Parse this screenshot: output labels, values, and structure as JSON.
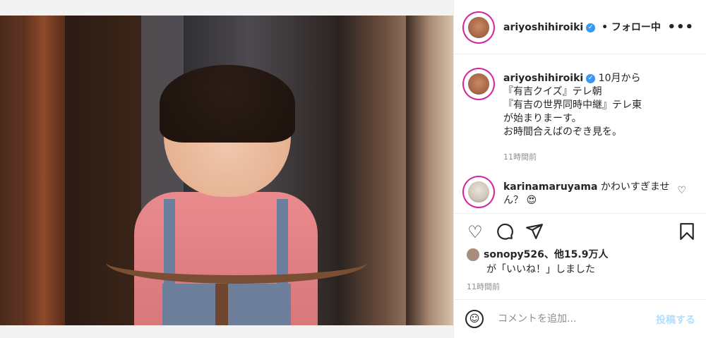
{
  "post": {
    "image_alt": "toddler smiling holding handlebar",
    "username": "ariyoshihiroiki",
    "verified": true,
    "separator": "•",
    "follow_status": "フォロー中",
    "more_icon": "more-icon"
  },
  "caption": {
    "username": "ariyoshihiroiki",
    "lines": [
      "10月から",
      "『有吉クイズ』テレ朝",
      "『有吉の世界同時中継』テレ東",
      "が始まりまーす。",
      "お時間合えばのぞき見を。"
    ],
    "time": "11時間前"
  },
  "comment": {
    "username": "karinamaruyama",
    "text": "かわいすぎません？",
    "emoji": "😍"
  },
  "likes": {
    "user": "sonopy526",
    "others": "、他15.9万人",
    "suffix": "が「いいね！」しました"
  },
  "time": "11時間前",
  "comment_box": {
    "placeholder": "コメントを追加...",
    "post_label": "投稿する"
  },
  "colors": {
    "verified": "#3897f0",
    "post_disabled": "#b2dffc",
    "story_ring": "#d6249f"
  }
}
